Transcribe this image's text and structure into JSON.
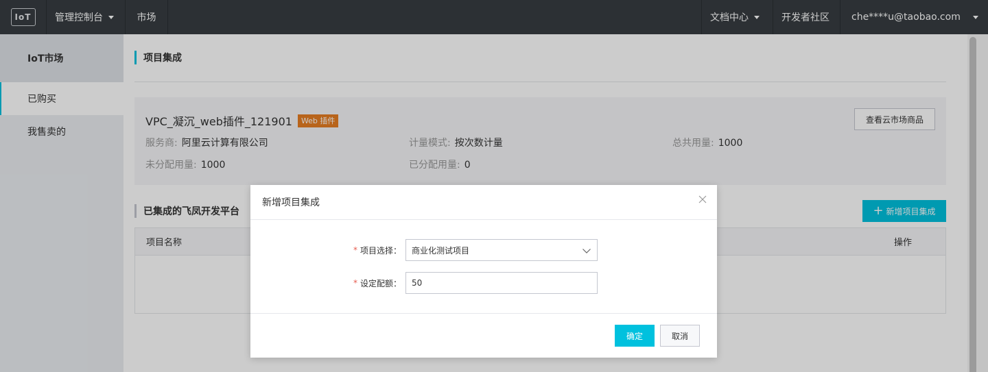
{
  "topbar": {
    "logo_text": "IoT",
    "console_label": "管理控制台",
    "market_label": "市场",
    "docs_label": "文档中心",
    "community_label": "开发者社区",
    "account_label": "che****u@taobao.com"
  },
  "sidebar": {
    "title": "IoT市场",
    "items": [
      {
        "label": "已购买"
      },
      {
        "label": "我售卖的"
      }
    ]
  },
  "main": {
    "section_title": "项目集成",
    "product": {
      "name": "VPC_凝沉_web插件_121901",
      "tag": "Web 插件",
      "view_button": "查看云市场商品",
      "provider_label": "服务商:",
      "provider_value": "阿里云计算有限公司",
      "metering_label": "计量模式:",
      "metering_value": "按次数计量",
      "total_label": "总共用量:",
      "total_value": "1000",
      "unallocated_label": "未分配用量:",
      "unallocated_value": "1000",
      "allocated_label": "已分配用量:",
      "allocated_value": "0"
    },
    "integrated_title": "已集成的飞凤开发平台",
    "add_button": "新增项目集成",
    "table": {
      "columns": [
        "项目名称",
        "操作"
      ]
    }
  },
  "dialog": {
    "title": "新增项目集成",
    "project_label": "项目选择：",
    "project_value": "商业化测试项目",
    "quota_label": "设定配额：",
    "quota_value": "50",
    "ok_label": "确定",
    "cancel_label": "取消"
  },
  "colors": {
    "accent": "#00c1de",
    "tag": "#e67e22",
    "topbar": "#373d41"
  }
}
